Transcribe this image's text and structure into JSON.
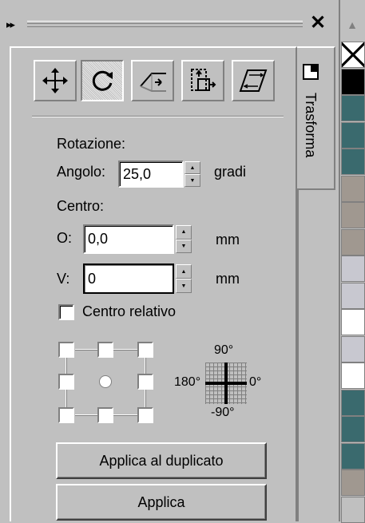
{
  "window": {
    "grip_glyph": "▸▸",
    "close_glyph": "✕",
    "tab_label": "Trasforma"
  },
  "modes": [
    {
      "id": "position",
      "icon": "move-arrows-icon",
      "active": false
    },
    {
      "id": "rotate",
      "icon": "rotate-icon",
      "active": true
    },
    {
      "id": "scale",
      "icon": "scale-mirror-icon",
      "active": false
    },
    {
      "id": "size",
      "icon": "size-icon",
      "active": false
    },
    {
      "id": "skew",
      "icon": "skew-icon",
      "active": false
    }
  ],
  "rotation": {
    "section_label": "Rotazione:",
    "angle_label": "Angolo:",
    "angle_value": "25,0",
    "angle_unit": "gradi",
    "center_label": "Centro:",
    "h_label": "O:",
    "h_value": "0,0",
    "h_unit": "mm",
    "v_label": "V:",
    "v_value": "0",
    "v_unit": "mm",
    "relative_label": "Centro relativo",
    "relative_checked": false
  },
  "dial": {
    "top": "90°",
    "left": "180°",
    "right": "0°",
    "bottom": "-90°"
  },
  "buttons": {
    "apply_duplicate": "Applica al duplicato",
    "apply": "Applica"
  },
  "palette": {
    "colors": [
      "none",
      "#000000",
      "#3a6a6e",
      "#3a6a6e",
      "#3a6a6e",
      "#a09890",
      "#a09890",
      "#a09890",
      "#c8c8d0",
      "#c8c8d0",
      "#ffffff",
      "#c8c8d0",
      "#ffffff",
      "#3a6a6e",
      "#3a6a6e",
      "#3a6a6e",
      "#a09890",
      "#c0c0c0"
    ]
  }
}
